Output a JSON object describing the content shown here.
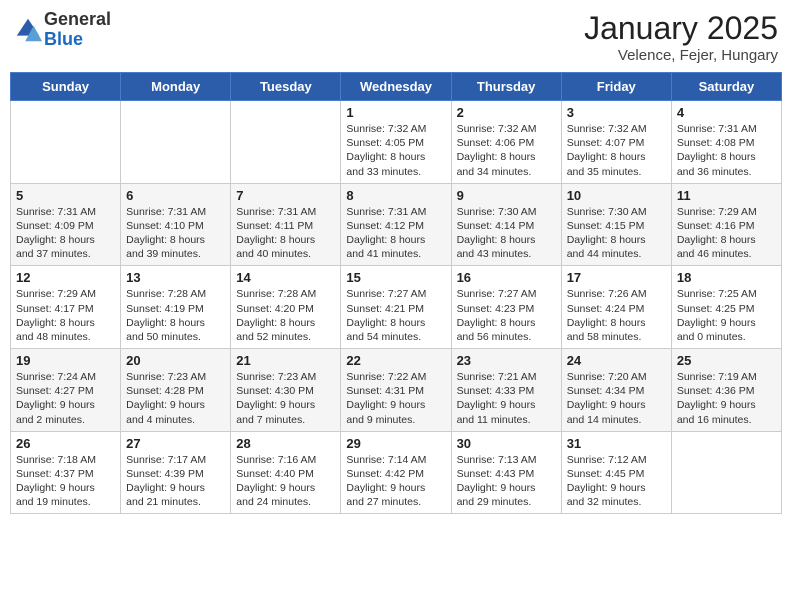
{
  "header": {
    "logo_general": "General",
    "logo_blue": "Blue",
    "title": "January 2025",
    "location": "Velence, Fejer, Hungary"
  },
  "days_of_week": [
    "Sunday",
    "Monday",
    "Tuesday",
    "Wednesday",
    "Thursday",
    "Friday",
    "Saturday"
  ],
  "weeks": [
    [
      {
        "day": "",
        "info": ""
      },
      {
        "day": "",
        "info": ""
      },
      {
        "day": "",
        "info": ""
      },
      {
        "day": "1",
        "info": "Sunrise: 7:32 AM\nSunset: 4:05 PM\nDaylight: 8 hours and 33 minutes."
      },
      {
        "day": "2",
        "info": "Sunrise: 7:32 AM\nSunset: 4:06 PM\nDaylight: 8 hours and 34 minutes."
      },
      {
        "day": "3",
        "info": "Sunrise: 7:32 AM\nSunset: 4:07 PM\nDaylight: 8 hours and 35 minutes."
      },
      {
        "day": "4",
        "info": "Sunrise: 7:31 AM\nSunset: 4:08 PM\nDaylight: 8 hours and 36 minutes."
      }
    ],
    [
      {
        "day": "5",
        "info": "Sunrise: 7:31 AM\nSunset: 4:09 PM\nDaylight: 8 hours and 37 minutes."
      },
      {
        "day": "6",
        "info": "Sunrise: 7:31 AM\nSunset: 4:10 PM\nDaylight: 8 hours and 39 minutes."
      },
      {
        "day": "7",
        "info": "Sunrise: 7:31 AM\nSunset: 4:11 PM\nDaylight: 8 hours and 40 minutes."
      },
      {
        "day": "8",
        "info": "Sunrise: 7:31 AM\nSunset: 4:12 PM\nDaylight: 8 hours and 41 minutes."
      },
      {
        "day": "9",
        "info": "Sunrise: 7:30 AM\nSunset: 4:14 PM\nDaylight: 8 hours and 43 minutes."
      },
      {
        "day": "10",
        "info": "Sunrise: 7:30 AM\nSunset: 4:15 PM\nDaylight: 8 hours and 44 minutes."
      },
      {
        "day": "11",
        "info": "Sunrise: 7:29 AM\nSunset: 4:16 PM\nDaylight: 8 hours and 46 minutes."
      }
    ],
    [
      {
        "day": "12",
        "info": "Sunrise: 7:29 AM\nSunset: 4:17 PM\nDaylight: 8 hours and 48 minutes."
      },
      {
        "day": "13",
        "info": "Sunrise: 7:28 AM\nSunset: 4:19 PM\nDaylight: 8 hours and 50 minutes."
      },
      {
        "day": "14",
        "info": "Sunrise: 7:28 AM\nSunset: 4:20 PM\nDaylight: 8 hours and 52 minutes."
      },
      {
        "day": "15",
        "info": "Sunrise: 7:27 AM\nSunset: 4:21 PM\nDaylight: 8 hours and 54 minutes."
      },
      {
        "day": "16",
        "info": "Sunrise: 7:27 AM\nSunset: 4:23 PM\nDaylight: 8 hours and 56 minutes."
      },
      {
        "day": "17",
        "info": "Sunrise: 7:26 AM\nSunset: 4:24 PM\nDaylight: 8 hours and 58 minutes."
      },
      {
        "day": "18",
        "info": "Sunrise: 7:25 AM\nSunset: 4:25 PM\nDaylight: 9 hours and 0 minutes."
      }
    ],
    [
      {
        "day": "19",
        "info": "Sunrise: 7:24 AM\nSunset: 4:27 PM\nDaylight: 9 hours and 2 minutes."
      },
      {
        "day": "20",
        "info": "Sunrise: 7:23 AM\nSunset: 4:28 PM\nDaylight: 9 hours and 4 minutes."
      },
      {
        "day": "21",
        "info": "Sunrise: 7:23 AM\nSunset: 4:30 PM\nDaylight: 9 hours and 7 minutes."
      },
      {
        "day": "22",
        "info": "Sunrise: 7:22 AM\nSunset: 4:31 PM\nDaylight: 9 hours and 9 minutes."
      },
      {
        "day": "23",
        "info": "Sunrise: 7:21 AM\nSunset: 4:33 PM\nDaylight: 9 hours and 11 minutes."
      },
      {
        "day": "24",
        "info": "Sunrise: 7:20 AM\nSunset: 4:34 PM\nDaylight: 9 hours and 14 minutes."
      },
      {
        "day": "25",
        "info": "Sunrise: 7:19 AM\nSunset: 4:36 PM\nDaylight: 9 hours and 16 minutes."
      }
    ],
    [
      {
        "day": "26",
        "info": "Sunrise: 7:18 AM\nSunset: 4:37 PM\nDaylight: 9 hours and 19 minutes."
      },
      {
        "day": "27",
        "info": "Sunrise: 7:17 AM\nSunset: 4:39 PM\nDaylight: 9 hours and 21 minutes."
      },
      {
        "day": "28",
        "info": "Sunrise: 7:16 AM\nSunset: 4:40 PM\nDaylight: 9 hours and 24 minutes."
      },
      {
        "day": "29",
        "info": "Sunrise: 7:14 AM\nSunset: 4:42 PM\nDaylight: 9 hours and 27 minutes."
      },
      {
        "day": "30",
        "info": "Sunrise: 7:13 AM\nSunset: 4:43 PM\nDaylight: 9 hours and 29 minutes."
      },
      {
        "day": "31",
        "info": "Sunrise: 7:12 AM\nSunset: 4:45 PM\nDaylight: 9 hours and 32 minutes."
      },
      {
        "day": "",
        "info": ""
      }
    ]
  ]
}
